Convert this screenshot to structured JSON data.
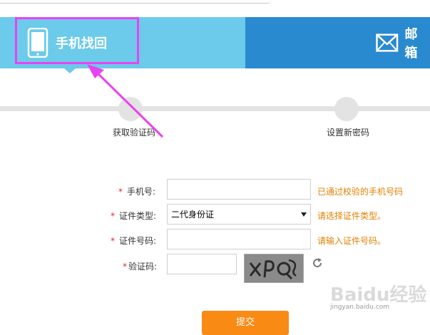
{
  "tabs": [
    {
      "label": "手机找回",
      "icon": "smartphone-icon"
    },
    {
      "label": "邮箱",
      "icon": "envelope-icon"
    }
  ],
  "steps": [
    {
      "label": "获取验证码"
    },
    {
      "label": "设置新密码"
    }
  ],
  "form": {
    "required_mark": "*",
    "phone": {
      "label": "手机号:",
      "value": "",
      "hint": "已通过校验的手机号码"
    },
    "id_type": {
      "label": "证件类型:",
      "selected": "二代身份证",
      "hint": "请选择证件类型。"
    },
    "id_number": {
      "label": "证件号码:",
      "value": "",
      "hint": "请输入证件号码。"
    },
    "captcha": {
      "label": "验证码:",
      "value": "",
      "image_text": "XPQ",
      "refresh_icon": "refresh-icon"
    },
    "submit_label": "提交"
  },
  "watermark": {
    "brand": "Baidu经验",
    "url": "jingyan.baidu.com"
  },
  "colors": {
    "tab_active": "#6ccaea",
    "tab_inactive": "#2a8ad0",
    "highlight": "#e843f0",
    "required": "#e0262f",
    "hint": "#e28100",
    "submit": "#f98a14"
  }
}
